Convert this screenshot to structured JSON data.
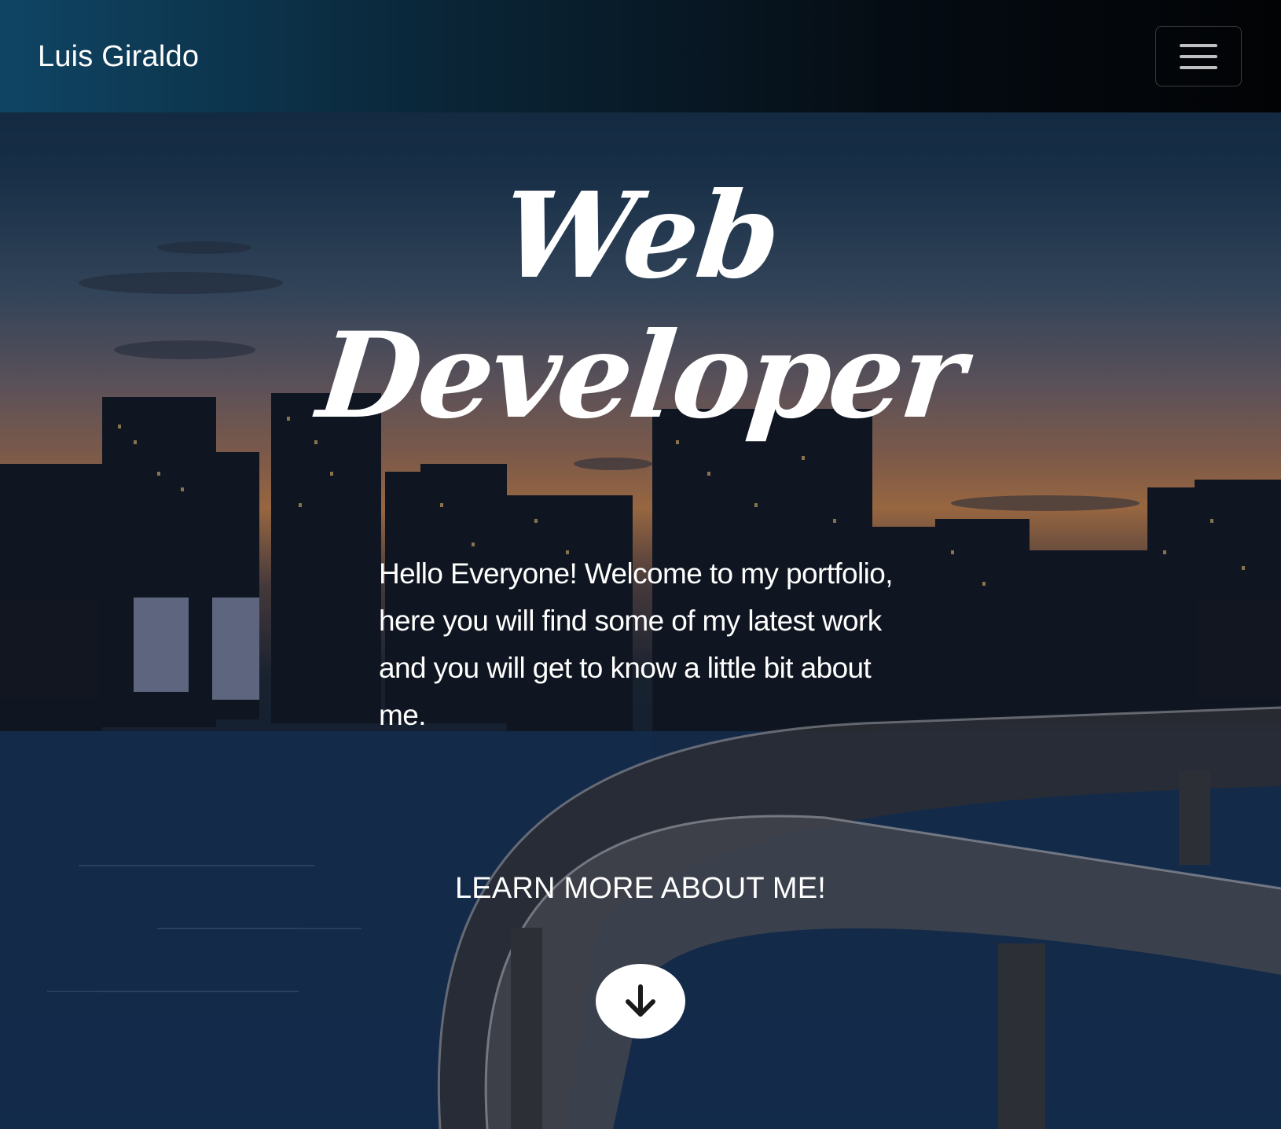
{
  "navbar": {
    "brand": "Luis Giraldo",
    "menu_icon": "hamburger-menu-icon"
  },
  "hero": {
    "title_line1": "Web",
    "title_line2": "Developer",
    "intro": "Hello Everyone! Welcome to my portfolio, here you will find some of my latest work and you will get to know a little bit about me.",
    "cta_label": "LEARN MORE ABOUT ME!",
    "scroll_icon": "arrow-down-icon"
  },
  "colors": {
    "text": "#ffffff",
    "navbar_start": "#0f4564",
    "navbar_end": "#020305",
    "button_bg": "#ffffff",
    "arrow": "#1a1a1a"
  }
}
